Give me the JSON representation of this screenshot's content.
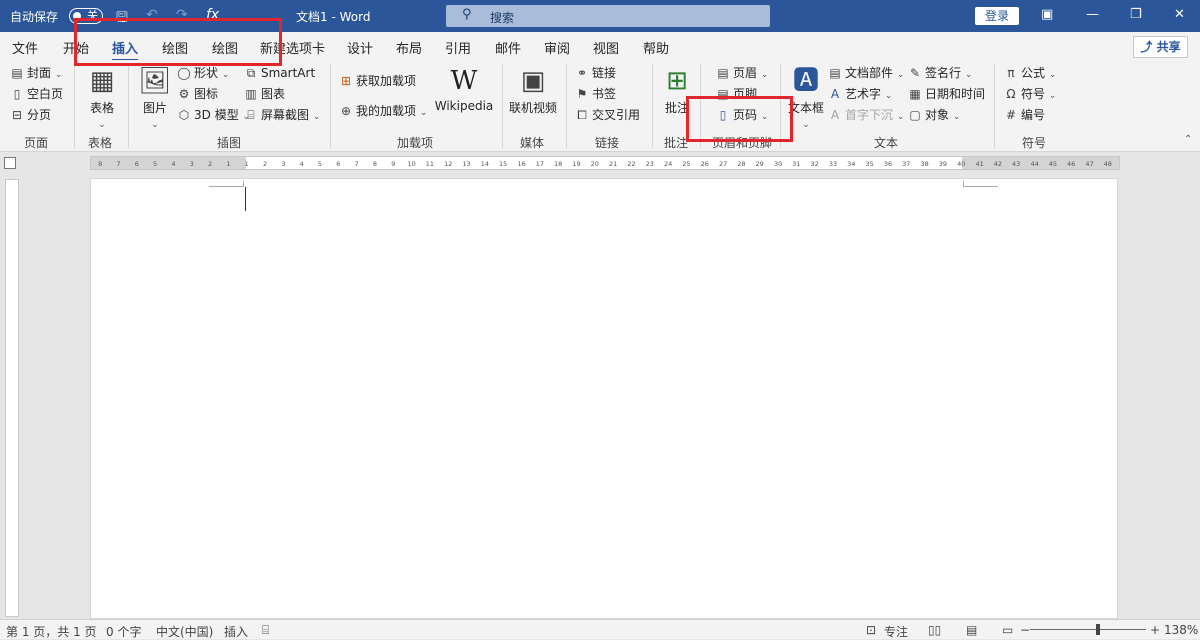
{
  "titlebar": {
    "autosave_label": "自动保存",
    "autosave_state": "关",
    "doc_title": "文档1  -  Word",
    "search_placeholder": "搜索",
    "login_label": "登录",
    "share_label": "共享"
  },
  "tabs": [
    "文件",
    "开始",
    "插入",
    "绘图",
    "绘图",
    "新建选项卡",
    "设计",
    "布局",
    "引用",
    "邮件",
    "审阅",
    "视图",
    "帮助"
  ],
  "active_tab": "插入",
  "ribbon": {
    "pages": {
      "cover": "封面",
      "blank": "空白页",
      "break": "分页",
      "group": "页面"
    },
    "tables": {
      "table": "表格",
      "group": "表格"
    },
    "illustrations": {
      "picture": "图片",
      "shapes": "形状",
      "icons": "图标",
      "model3d": "3D 模型",
      "smartart": "SmartArt",
      "chart": "图表",
      "screenshot": "屏幕截图",
      "group": "插图"
    },
    "addins": {
      "get": "获取加载项",
      "mine": "我的加载项",
      "wiki": "Wikipedia",
      "group": "加载项"
    },
    "media": {
      "video": "联机视频",
      "group": "媒体"
    },
    "links": {
      "link": "链接",
      "bookmark": "书签",
      "crossref": "交叉引用",
      "group": "链接"
    },
    "comments": {
      "comment": "批注",
      "group": "批注"
    },
    "headerfooter": {
      "header": "页眉",
      "footer": "页脚",
      "pagenum": "页码",
      "group": "页眉和页脚"
    },
    "text": {
      "textbox": "文本框",
      "quickparts": "文档部件",
      "wordart": "艺术字",
      "dropcap": "首字下沉",
      "signature": "签名行",
      "datetime": "日期和时间",
      "object": "对象",
      "group": "文本"
    },
    "symbols": {
      "equation": "公式",
      "symbol": "符号",
      "number": "编号",
      "group": "符号"
    }
  },
  "ruler_numbers": [
    "8",
    "7",
    "6",
    "5",
    "4",
    "3",
    "2",
    "1",
    "1",
    "2",
    "3",
    "4",
    "5",
    "6",
    "7",
    "8",
    "9",
    "10",
    "11",
    "12",
    "13",
    "14",
    "15",
    "16",
    "17",
    "18",
    "19",
    "20",
    "21",
    "22",
    "23",
    "24",
    "25",
    "26",
    "27",
    "28",
    "29",
    "30",
    "31",
    "32",
    "33",
    "34",
    "35",
    "36",
    "37",
    "38",
    "39",
    "40",
    "41",
    "42",
    "43",
    "44",
    "45",
    "46",
    "47",
    "48"
  ],
  "statusbar": {
    "page": "第 1 页，共 1 页",
    "words": "0 个字",
    "language": "中文(中国)",
    "mode": "插入",
    "focus": "专注",
    "zoom": "138%"
  },
  "icons": [
    "toggle-icon",
    "save-icon",
    "undo-icon",
    "redo-icon",
    "formula-icon",
    "search-icon",
    "restore-icon",
    "minimize-icon",
    "maximize-icon",
    "close-icon"
  ]
}
